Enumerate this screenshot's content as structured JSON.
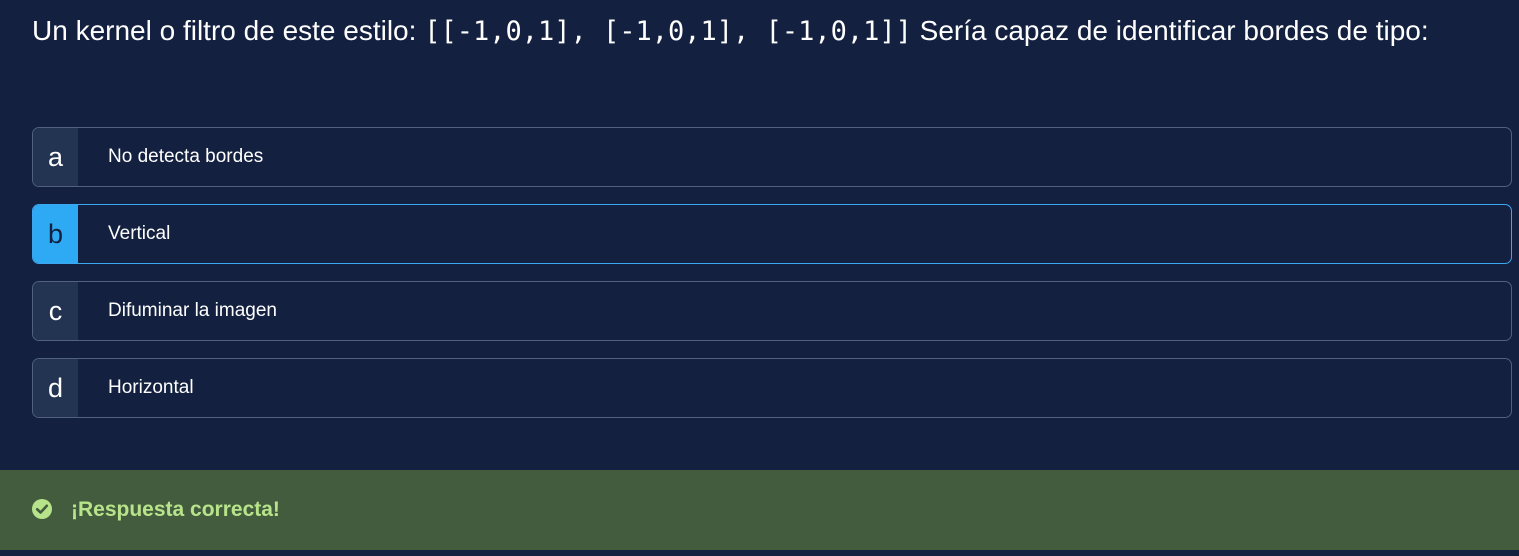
{
  "question": {
    "prefix": "Un kernel o filtro de este estilo: ",
    "code": "[[-1,0,1], [-1,0,1], [-1,0,1]]",
    "suffix": " Sería capaz de identificar bordes de tipo:"
  },
  "options": [
    {
      "letter": "a",
      "label": "No detecta bordes",
      "selected": false
    },
    {
      "letter": "b",
      "label": "Vertical",
      "selected": true
    },
    {
      "letter": "c",
      "label": "Difuminar la imagen",
      "selected": false
    },
    {
      "letter": "d",
      "label": "Horizontal",
      "selected": false
    }
  ],
  "feedback": {
    "icon": "check-circle-icon",
    "message": "¡Respuesta correcta!"
  },
  "colors": {
    "background": "#13203f",
    "selected_accent": "#2ea9f4",
    "feedback_bg": "#435c3e",
    "feedback_text": "#b7e38a"
  }
}
